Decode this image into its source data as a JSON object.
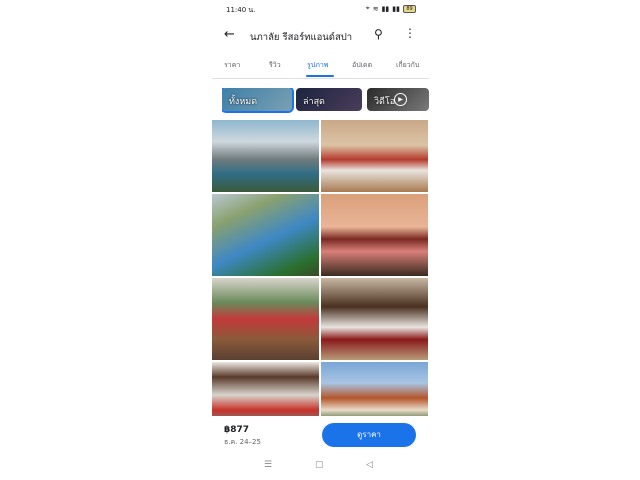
{
  "status": {
    "time": "11:40 น.",
    "battery": "89"
  },
  "header": {
    "title": "นภาลัย รีสอร์ทแอนด์สปา"
  },
  "tabs": [
    {
      "label": "ราคา"
    },
    {
      "label": "รีวิว"
    },
    {
      "label": "รูปภาพ"
    },
    {
      "label": "อัปเดต"
    },
    {
      "label": "เกี่ยวกับ"
    }
  ],
  "chips": [
    {
      "label": "ทั้งหมด"
    },
    {
      "label": "ล่าสุด"
    },
    {
      "label": "วิดีโอ"
    }
  ],
  "footer": {
    "price": "฿877",
    "dates": "ธ.ค. 24–25",
    "cta": "ดูราคา"
  },
  "icons": {
    "back": "arrow-back-icon",
    "search": "search-icon",
    "more": "more-vert-icon"
  },
  "colors": {
    "accent": "#1a73e8"
  }
}
